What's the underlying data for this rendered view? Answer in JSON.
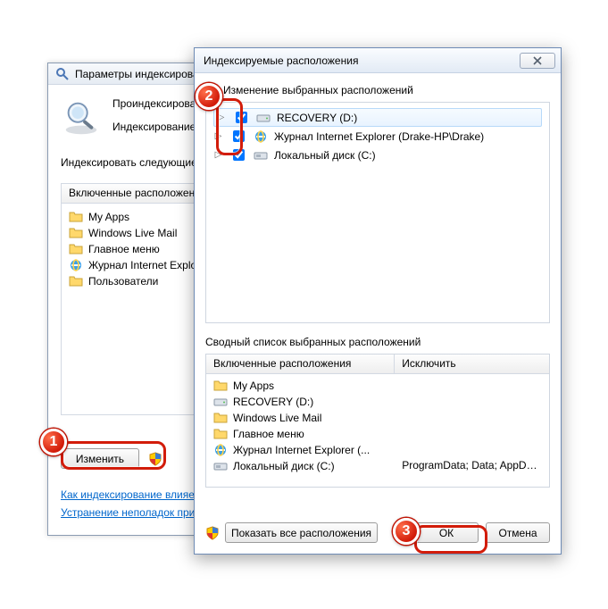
{
  "backWindow": {
    "title": "Параметры индексирования",
    "line1": "Проиндексировано",
    "line2": "Индексирование",
    "idxLabel": "Индексировать следующие расположения:",
    "gridHeader": "Включенные расположения",
    "items": [
      {
        "icon": "folder",
        "label": "My Apps"
      },
      {
        "icon": "folder",
        "label": "Windows Live Mail"
      },
      {
        "icon": "folder",
        "label": "Главное меню"
      },
      {
        "icon": "ie",
        "label": "Журнал Internet Explorer"
      },
      {
        "icon": "folder",
        "label": "Пользователи"
      }
    ],
    "btnModify": "Изменить",
    "link1": "Как индексирование влияет на поиск?",
    "link2": "Устранение неполадок при поиске и индексировании"
  },
  "frontWindow": {
    "title": "Индексируемые расположения",
    "changeSelLabel": "Изменение выбранных расположений",
    "tree": [
      {
        "icon": "drive",
        "label": "RECOVERY (D:)",
        "checked": true
      },
      {
        "icon": "ie",
        "label": "Журнал Internet Explorer (Drake-HP\\Drake)",
        "checked": true
      },
      {
        "icon": "disk",
        "label": "Локальный диск (C:)",
        "checked": true
      }
    ],
    "summaryLabel": "Сводный список выбранных расположений",
    "summaryHead": {
      "c1": "Включенные расположения",
      "c2": "Исключить"
    },
    "summaryRows": [
      {
        "icon": "folder",
        "l": "My Apps",
        "r": ""
      },
      {
        "icon": "drive",
        "l": "RECOVERY (D:)",
        "r": ""
      },
      {
        "icon": "folder",
        "l": "Windows Live Mail",
        "r": ""
      },
      {
        "icon": "folder",
        "l": "Главное меню",
        "r": ""
      },
      {
        "icon": "ie",
        "l": "Журнал Internet Explorer (...",
        "r": ""
      },
      {
        "icon": "disk",
        "l": "Локальный диск (C:)",
        "r": "ProgramData; Data; AppData;..."
      }
    ],
    "showAll": "Показать все расположения",
    "ok": "ОК",
    "cancel": "Отмена"
  },
  "callouts": {
    "n1": "1",
    "n2": "2",
    "n3": "3"
  }
}
